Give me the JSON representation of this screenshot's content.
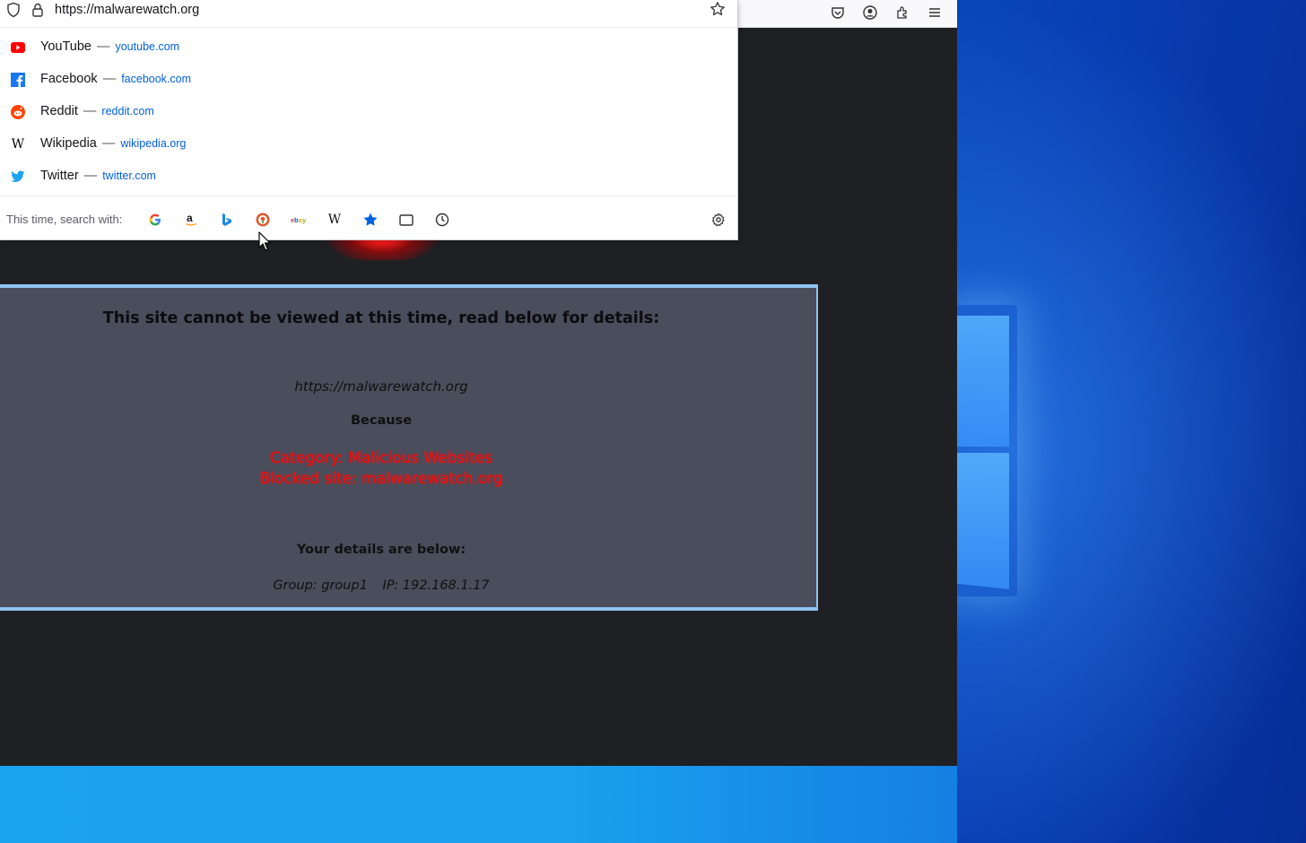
{
  "browser": {
    "url": "https://malwarewatch.org",
    "toolbar_icons": [
      "pocket-icon",
      "account-icon",
      "extensions-icon",
      "menu-icon"
    ]
  },
  "suggestions": [
    {
      "title": "YouTube",
      "url": "youtube.com",
      "icon": "youtube-icon",
      "color": "#ff0000"
    },
    {
      "title": "Facebook",
      "url": "facebook.com",
      "icon": "facebook-icon",
      "color": "#1877f2"
    },
    {
      "title": "Reddit",
      "url": "reddit.com",
      "icon": "reddit-icon",
      "color": "#ff4500"
    },
    {
      "title": "Wikipedia",
      "url": "wikipedia.org",
      "icon": "wikipedia-icon",
      "color": "#000000"
    },
    {
      "title": "Twitter",
      "url": "twitter.com",
      "icon": "twitter-icon",
      "color": "#1da1f2"
    }
  ],
  "search_row": {
    "label": "This time, search with:",
    "engines": [
      "google-icon",
      "amazon-icon",
      "bing-icon",
      "duckduckgo-icon",
      "ebay-icon",
      "wikipedia-icon",
      "bookmarks-icon",
      "tabs-icon",
      "history-icon"
    ]
  },
  "block_page": {
    "title": "This site cannot be viewed at this time, read below for details:",
    "blocked_url": "https://malwarewatch.org",
    "because": "Because",
    "category": "Category: Malicious Websites",
    "blocked_site": "Blocked site: malwarewatch.org",
    "details_title": "Your details are below:",
    "group": "Group: group1",
    "ip": "IP: 192.168.1.17"
  },
  "colors": {
    "accent_link": "#0061e0",
    "block_reason": "#ee1111",
    "panel_bg": "#4a4d5b",
    "panel_border": "#8fc3f2"
  }
}
